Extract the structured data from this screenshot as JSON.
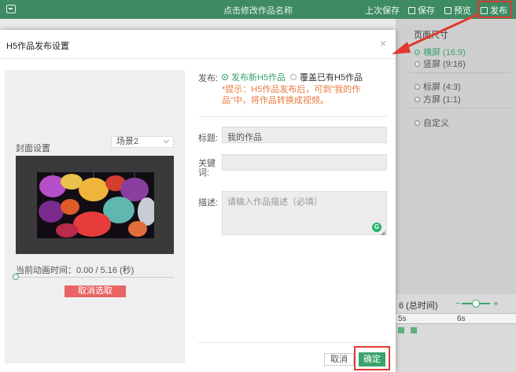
{
  "topbar": {
    "doc_title": "点击修改作品名称",
    "last_save": "上次保存",
    "save": "保存",
    "preview": "预览",
    "publish": "发布"
  },
  "right_panel": {
    "title": "页面尺寸",
    "sizes": [
      {
        "label": "横屏 (16:9)",
        "selected": true
      },
      {
        "label": "竖屏 (9:16)",
        "selected": false
      },
      {
        "label": "标屏 (4:3)",
        "selected": false
      },
      {
        "label": "方屏 (1:1)",
        "selected": false
      },
      {
        "label": "自定义",
        "selected": false
      }
    ]
  },
  "timeline": {
    "total_label": "6 (总时间)",
    "ruler_labels": [
      "5s",
      "6s"
    ]
  },
  "dialog": {
    "title": "H5作品发布设置",
    "close_icon": "close-icon",
    "cover_label": "封面设置",
    "scene_select_value": "场景2",
    "anim_time": "当前动画时间：0.00 / 5.16 (秒)",
    "cancel_select": "取消选取",
    "publish_label": "发布:",
    "option_new": "发布新H5作品",
    "option_overwrite": "覆盖已有H5作品",
    "tip": "*提示：H5作品发布后，可到\"我的作品\"中，将作品转换成视频。",
    "title_label": "标题:",
    "title_value": "我的作品",
    "keywords_label": "关键词:",
    "keywords_value": "",
    "desc_label": "描述:",
    "desc_placeholder": "请输入作品描述（必填）",
    "btn_cancel": "取消",
    "btn_ok": "确定",
    "accent_color": "#3aa36b",
    "highlight_color": "#e03a32"
  }
}
